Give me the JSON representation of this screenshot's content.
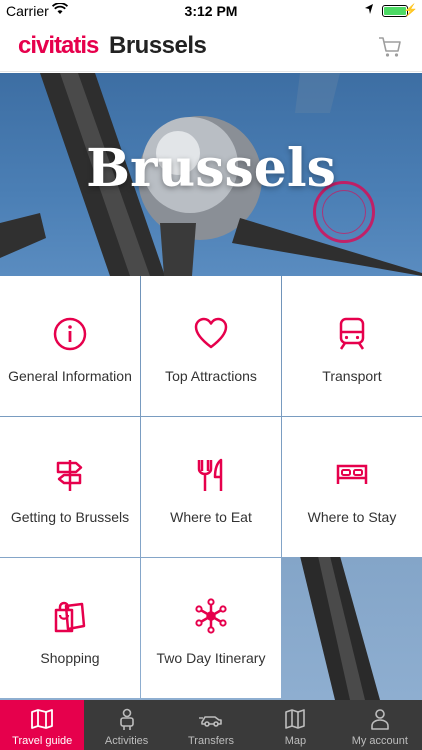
{
  "status_bar": {
    "carrier": "Carrier",
    "time": "3:12 PM"
  },
  "header": {
    "brand": "civitatis",
    "city": "Brussels"
  },
  "hero": {
    "title": "Brussels"
  },
  "tiles": [
    {
      "label": "General Information",
      "icon": "info-icon"
    },
    {
      "label": "Top Attractions",
      "icon": "heart-icon"
    },
    {
      "label": "Transport",
      "icon": "train-icon"
    },
    {
      "label": "Getting to Brussels",
      "icon": "signpost-icon"
    },
    {
      "label": "Where to Eat",
      "icon": "fork-knife-icon"
    },
    {
      "label": "Where to Stay",
      "icon": "bed-icon"
    },
    {
      "label": "Shopping",
      "icon": "shopping-bag-icon"
    },
    {
      "label": "Two Day Itinerary",
      "icon": "itinerary-icon"
    }
  ],
  "tabbar": {
    "items": [
      {
        "label": "Travel guide",
        "icon": "map-book-icon",
        "active": true
      },
      {
        "label": "Activities",
        "icon": "person-icon"
      },
      {
        "label": "Transfers",
        "icon": "car-icon"
      },
      {
        "label": "Map",
        "icon": "map-icon"
      },
      {
        "label": "My account",
        "icon": "user-icon"
      }
    ]
  },
  "colors": {
    "accent": "#e6004c",
    "tabbar": "#3a3a3a",
    "active_tab": "#e6004c"
  }
}
